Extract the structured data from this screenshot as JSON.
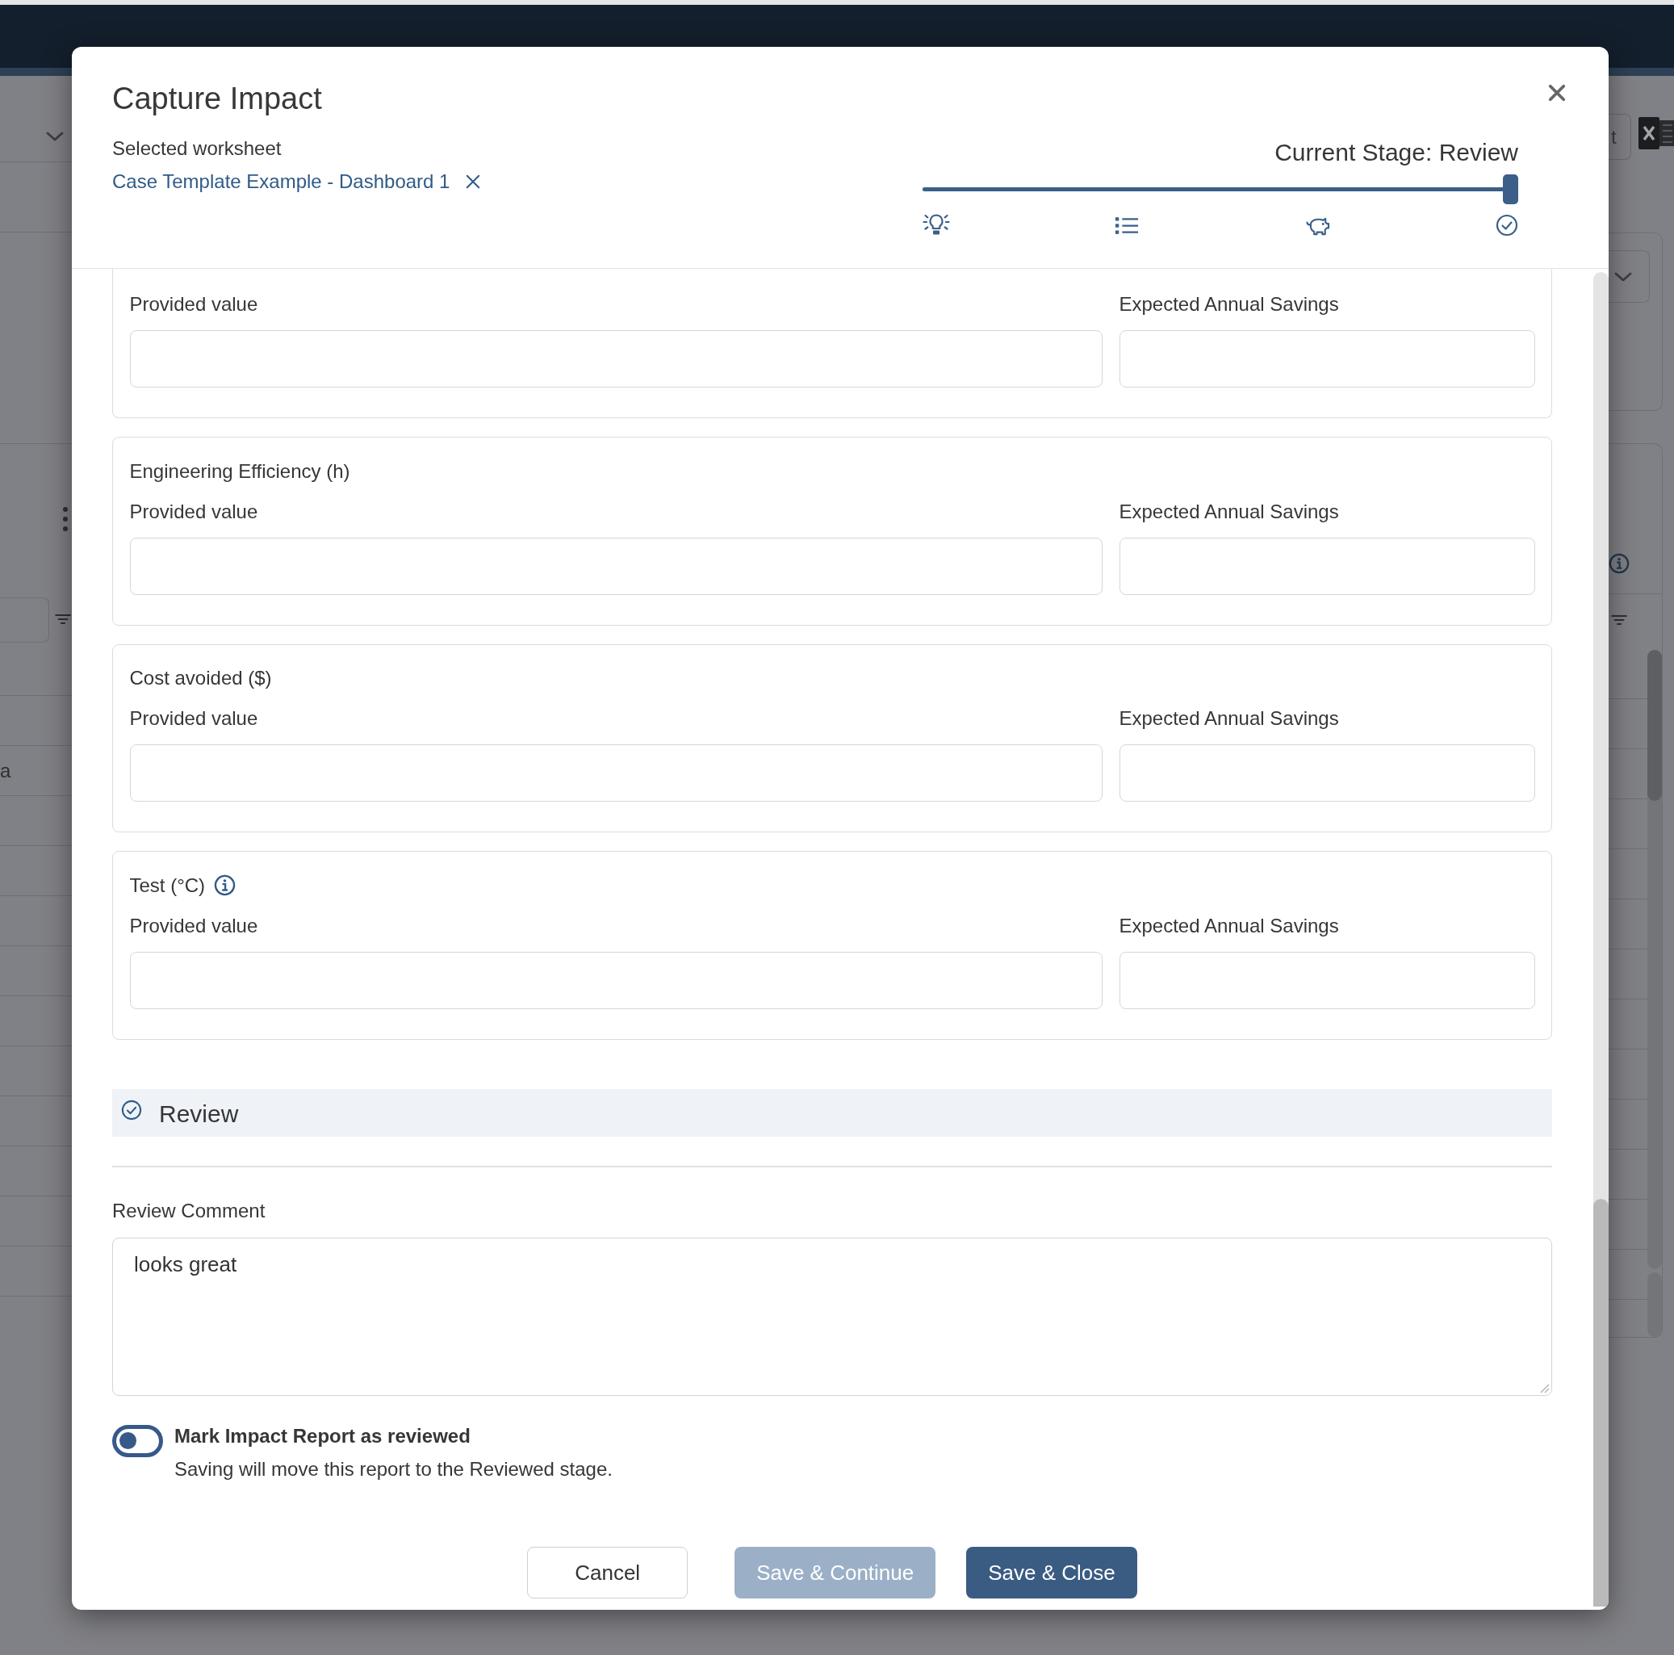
{
  "background": {
    "table_cell": "a",
    "toolbar_button": "t"
  },
  "dialog": {
    "title": "Capture Impact",
    "worksheet_label": "Selected worksheet",
    "worksheet_link": "Case Template Example - Dashboard 1",
    "stage": {
      "label": "Current Stage: Review",
      "level": 1
    },
    "sections": [
      {
        "fields": [
          {
            "label": "Provided value"
          },
          {
            "label": "Expected Annual Savings"
          }
        ]
      },
      {
        "title": "Engineering Efficiency (h)",
        "info": false,
        "fields": [
          {
            "label": "Provided value"
          },
          {
            "label": "Expected Annual Savings"
          }
        ]
      },
      {
        "title": "Cost avoided ($)",
        "info": false,
        "fields": [
          {
            "label": "Provided value"
          },
          {
            "label": "Expected Annual Savings"
          }
        ]
      },
      {
        "title": "Test (°C)",
        "info": true,
        "fields": [
          {
            "label": "Provided value"
          },
          {
            "label": "Expected Annual Savings"
          }
        ]
      }
    ],
    "review": {
      "heading": "Review",
      "comment_label": "Review Comment",
      "comment": "looks great",
      "toggle": {
        "label": "Mark Impact Report as reviewed",
        "description": "Saving will move this report to the Reviewed stage.",
        "checked": false
      }
    },
    "buttons": [
      {
        "label": "Cancel",
        "kind": "secondary",
        "disabled": false
      },
      {
        "label": "Save & Continue",
        "kind": "primary",
        "disabled": true
      },
      {
        "label": "Save & Close",
        "kind": "primary",
        "disabled": false
      }
    ]
  }
}
